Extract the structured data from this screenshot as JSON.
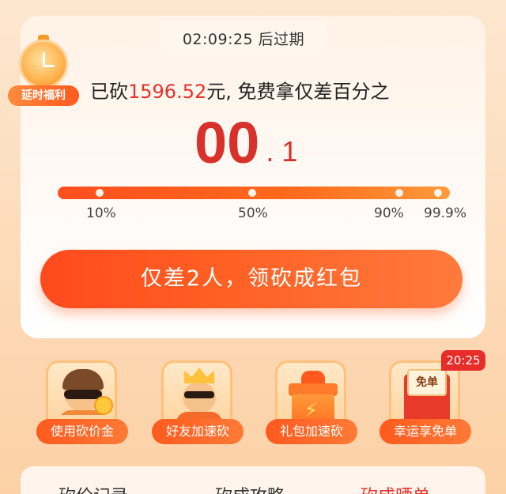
{
  "timer": {
    "text": "02:09:25 后过期"
  },
  "badge": {
    "label": "延时福利"
  },
  "headline": {
    "prefix": "已砍",
    "amount": "1596.52",
    "suffix": "元, 免费拿仅差百分之"
  },
  "percent_remaining": {
    "whole": "00",
    "fraction": ". 1"
  },
  "progress": {
    "ticks": [
      "10%",
      "50%",
      "90%",
      "99.9%"
    ],
    "value_percent": 99.9
  },
  "cta": {
    "label": "仅差2人，领砍成红包"
  },
  "features": [
    {
      "label": "使用砍价金",
      "icon": "thief-icon"
    },
    {
      "label": "好友加速砍",
      "icon": "king-icon"
    },
    {
      "label": "礼包加速砍",
      "icon": "gift-box-icon"
    },
    {
      "label": "幸运享免单",
      "icon": "coupon-icon",
      "icon_text": "免单",
      "badge": "20:25"
    }
  ],
  "bottom_tabs": [
    "砍价记录",
    "砍成攻略",
    "砍成晒单"
  ],
  "colors": {
    "accent": "#ff5a1e",
    "price_red": "#e6322a",
    "background": "#fde7cf"
  }
}
